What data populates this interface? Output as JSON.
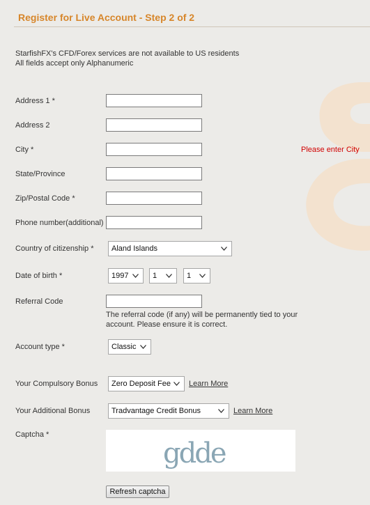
{
  "header": {
    "title": "Register for Live Account - Step 2 of 2"
  },
  "notice": {
    "line1": "StarfishFX's CFD/Forex services are not available to US residents",
    "line2": "All fields accept only Alphanumeric"
  },
  "fields": {
    "address1": {
      "label": "Address 1 *",
      "value": ""
    },
    "address2": {
      "label": "Address 2",
      "value": ""
    },
    "city": {
      "label": "City *",
      "value": "",
      "error": "Please enter City"
    },
    "state": {
      "label": "State/Province",
      "value": ""
    },
    "zip": {
      "label": "Zip/Postal Code *",
      "value": ""
    },
    "phone": {
      "label": "Phone number(additional)",
      "value": ""
    },
    "country": {
      "label": "Country of citizenship *",
      "selected": "Aland Islands"
    },
    "dob": {
      "label": "Date of birth *",
      "year": "1997",
      "month": "1",
      "day": "1"
    },
    "referral": {
      "label": "Referral Code",
      "value": "",
      "hint1": "The referral code (if any) will be permanently tied to your",
      "hint2": "account. Please ensure it is correct."
    },
    "account_type": {
      "label": "Account type *",
      "selected": "Classic"
    },
    "compulsory_bonus": {
      "label": "Your Compulsory Bonus",
      "selected": "Zero Deposit Fee",
      "link": "Learn More"
    },
    "additional_bonus": {
      "label": "Your Additional Bonus",
      "selected": "Tradvantage Credit Bonus",
      "link": "Learn More"
    },
    "captcha": {
      "label": "Captcha *",
      "image_text": "gdde"
    }
  },
  "buttons": {
    "refresh_captcha": "Refresh captcha"
  },
  "colors": {
    "title": "#d7862a",
    "error": "#d10000",
    "background": "#ecebe8"
  }
}
